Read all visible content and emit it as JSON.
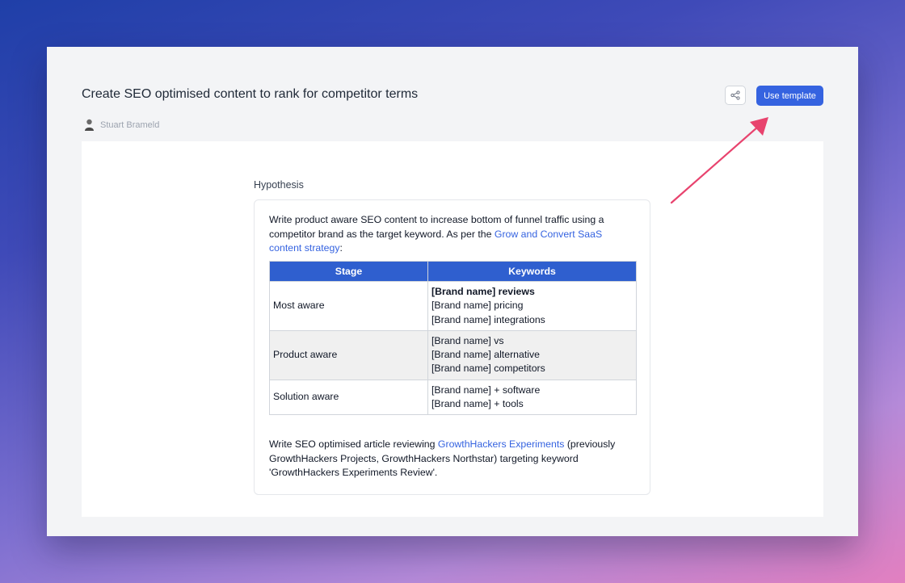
{
  "page": {
    "title": "Create SEO optimised content to rank for competitor terms",
    "author": "Stuart Brameld",
    "actions": {
      "share_icon": "share-icon",
      "use_template_label": "Use template"
    }
  },
  "hypothesis": {
    "label": "Hypothesis",
    "intro_before_link": "Write product aware SEO content to increase bottom of funnel traffic using a competitor brand as the target keyword. As per the ",
    "intro_link": "Grow and Convert SaaS content strategy",
    "intro_after_link": ":",
    "table": {
      "headers": [
        "Stage",
        "Keywords"
      ],
      "rows": [
        {
          "stage": "Most aware",
          "keywords": [
            "[Brand name] reviews",
            "[Brand name] pricing",
            "[Brand name] integrations"
          ]
        },
        {
          "stage": "Product aware",
          "keywords": [
            "[Brand name] vs",
            "[Brand name] alternative",
            "[Brand name] competitors"
          ]
        },
        {
          "stage": "Solution aware",
          "keywords": [
            "[Brand name] + software",
            "[Brand name] + tools"
          ]
        }
      ]
    },
    "outro_before_link": "Write SEO optimised article reviewing ",
    "outro_link": "GrowthHackers Experiments",
    "outro_after_link": " (previously GrowthHackers Projects, GrowthHackers Northstar) targeting keyword 'GrowthHackers Experiments Review'."
  },
  "colors": {
    "accent": "#3563e0",
    "table_header": "#2f5fcf",
    "annotation_arrow": "#e8436e"
  }
}
